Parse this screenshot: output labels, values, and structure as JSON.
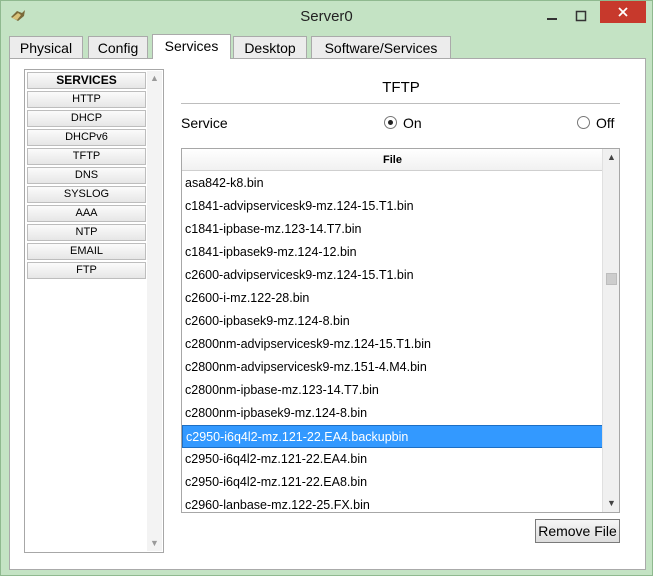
{
  "window": {
    "title": "Server0"
  },
  "tabs": [
    {
      "label": "Physical"
    },
    {
      "label": "Config"
    },
    {
      "label": "Services",
      "active": true
    },
    {
      "label": "Desktop"
    },
    {
      "label": "Software/Services"
    }
  ],
  "sidebar": {
    "header": "SERVICES",
    "items": [
      "HTTP",
      "DHCP",
      "DHCPv6",
      "TFTP",
      "DNS",
      "SYSLOG",
      "AAA",
      "NTP",
      "EMAIL",
      "FTP"
    ]
  },
  "tftp": {
    "title": "TFTP",
    "service_label": "Service",
    "on_label": "On",
    "off_label": "Off",
    "service_state": "On"
  },
  "file_table": {
    "header": "File",
    "selected_index": 11,
    "files": [
      "asa842-k8.bin",
      "c1841-advipservicesk9-mz.124-15.T1.bin",
      "c1841-ipbase-mz.123-14.T7.bin",
      "c1841-ipbasek9-mz.124-12.bin",
      "c2600-advipservicesk9-mz.124-15.T1.bin",
      "c2600-i-mz.122-28.bin",
      "c2600-ipbasek9-mz.124-8.bin",
      "c2800nm-advipservicesk9-mz.124-15.T1.bin",
      "c2800nm-advipservicesk9-mz.151-4.M4.bin",
      "c2800nm-ipbase-mz.123-14.T7.bin",
      "c2800nm-ipbasek9-mz.124-8.bin",
      "c2950-i6q4l2-mz.121-22.EA4.backupbin",
      "c2950-i6q4l2-mz.121-22.EA4.bin",
      "c2950-i6q4l2-mz.121-22.EA8.bin",
      "c2960-lanbase-mz.122-25.FX.bin"
    ]
  },
  "buttons": {
    "remove_file": "Remove File"
  },
  "colors": {
    "selection": "#3399ff",
    "window_frame": "#c4e3c4",
    "close_button": "#c7392c"
  }
}
